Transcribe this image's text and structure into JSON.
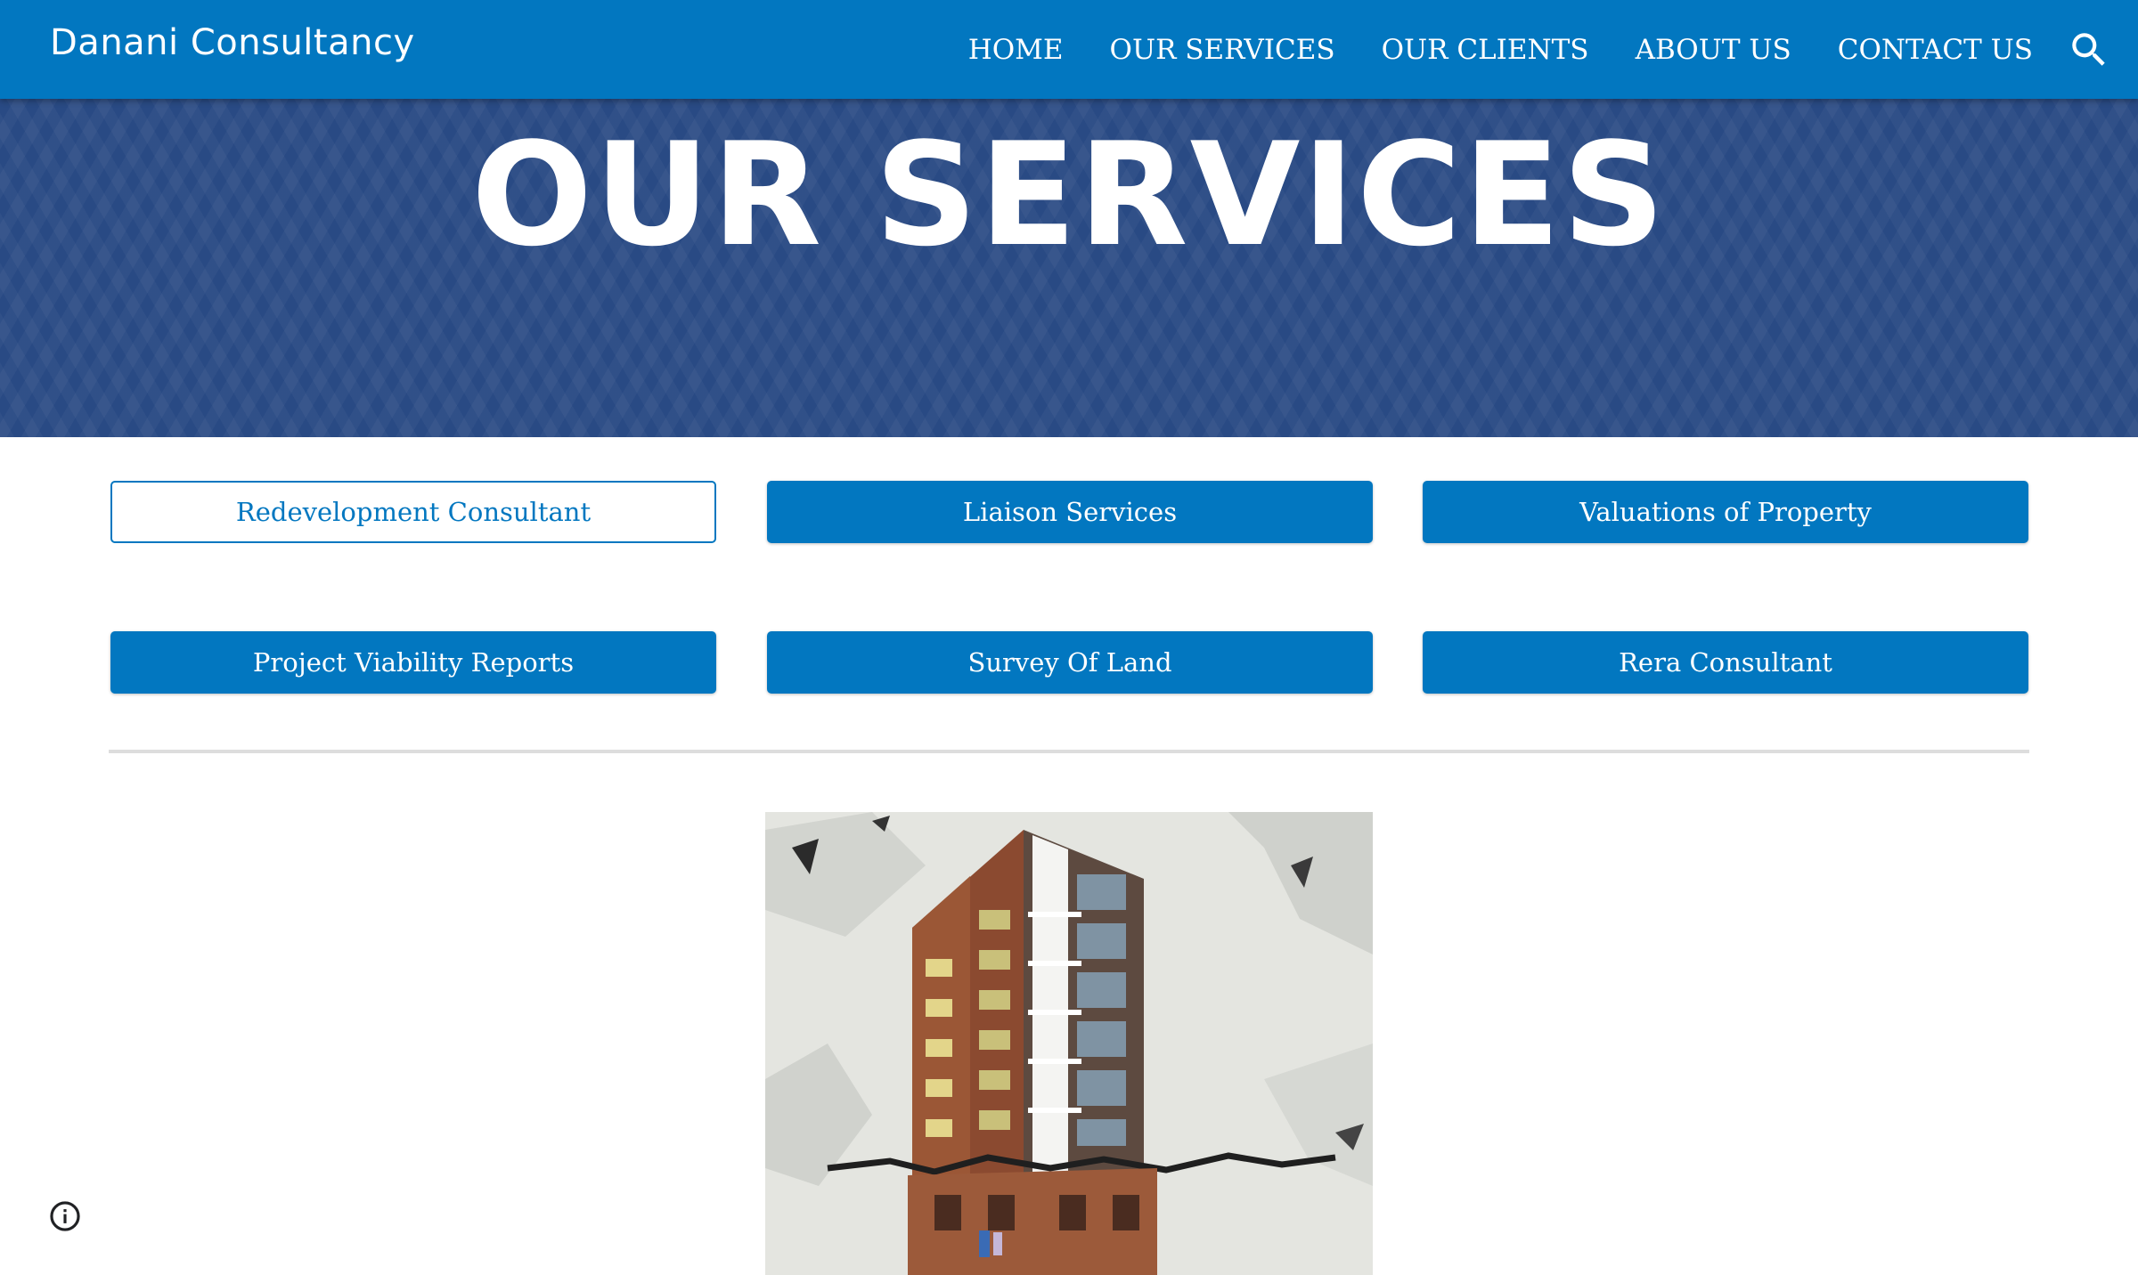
{
  "header": {
    "site_title": "Danani Consultancy",
    "nav": [
      {
        "label": "HOME"
      },
      {
        "label": "OUR SERVICES"
      },
      {
        "label": "OUR CLIENTS"
      },
      {
        "label": "ABOUT US"
      },
      {
        "label": "CONTACT US"
      }
    ],
    "search_icon": "search-icon"
  },
  "hero": {
    "title": "OUR SERVICES"
  },
  "services": [
    {
      "label": "Redevelopment Consultant",
      "style": "outline"
    },
    {
      "label": "Liaison Services",
      "style": "filled"
    },
    {
      "label": "Valuations of Property",
      "style": "filled"
    },
    {
      "label": "Project Viability Reports",
      "style": "filled"
    },
    {
      "label": "Survey Of Land",
      "style": "filled"
    },
    {
      "label": "Rera Consultant",
      "style": "filled"
    }
  ],
  "footer": {
    "info_icon": "info-icon"
  },
  "colors": {
    "primary": "#0277c0",
    "hero_bg": "#294a84",
    "divider": "#dddddd"
  }
}
